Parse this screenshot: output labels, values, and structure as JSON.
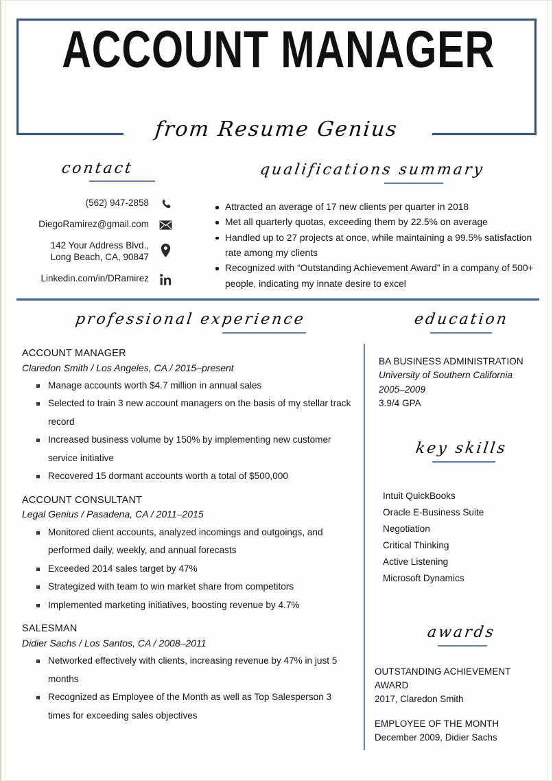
{
  "header": {
    "title": "ACCOUNT MANAGER",
    "subtitle": "from Resume Genius",
    "border_color": "#3d5574",
    "accent_color": "#4a6c96"
  },
  "sections": {
    "contact_heading": "contact",
    "qualifications_heading": "qualifications summary",
    "experience_heading": "professional experience",
    "education_heading": "education",
    "skills_heading": "key skills",
    "awards_heading": "awards"
  },
  "contact": {
    "items": [
      {
        "icon": "phone-icon",
        "lines": [
          "(562) 947-2858"
        ]
      },
      {
        "icon": "envelope-icon",
        "lines": [
          "DiegoRamirez@gmail.com"
        ]
      },
      {
        "icon": "location-pin-icon",
        "lines": [
          "142 Your Address Blvd.,",
          "Long Beach, CA, 90847"
        ]
      },
      {
        "icon": "linkedin-icon",
        "lines": [
          "Linkedin.com/in/DRamirez"
        ]
      }
    ],
    "phone": "(562) 947-2858",
    "email": "DiegoRamirez@gmail.com",
    "address_line1": "142 Your Address Blvd.,",
    "address_line2": "Long Beach, CA, 90847",
    "linkedin": "Linkedin.com/in/DRamirez"
  },
  "qualifications": [
    "Attracted an average of 17 new clients per quarter in 2018",
    "Met all quarterly quotas, exceeding them by 22.5% on average",
    "Handled up to 27 projects at once, while maintaining a 99.5% satisfaction rate among my clients",
    "Recognized with “Outstanding Achievement Award” in a company of 500+ people, indicating my innate desire to excel"
  ],
  "experience": [
    {
      "title": "ACCOUNT MANAGER",
      "meta": "Claredon Smith / Los Angeles, CA / 2015–present",
      "bullets": [
        "Manage accounts worth $4.7 million in annual sales",
        "Selected to train 3 new account managers on the basis of my stellar track record",
        "Increased business volume by 150% by implementing new customer service initiative",
        "Recovered 15 dormant accounts worth a total of $500,000"
      ]
    },
    {
      "title": "ACCOUNT CONSULTANT",
      "meta": "Legal Genius / Pasadena, CA  / 2011–2015",
      "bullets": [
        "Monitored client accounts, analyzed incomings and outgoings, and performed daily, weekly, and annual forecasts",
        "Exceeded 2014 sales target by 47%",
        "Strategized with team to win market share from competitors",
        "Implemented marketing initiatives, boosting revenue by 4.7%"
      ]
    },
    {
      "title": "SALESMAN",
      "meta": "Didier Sachs / Los Santos, CA / 2008–2011",
      "bullets": [
        "Networked effectively with clients, increasing revenue by 47% in just 5 months",
        "Recognized as Employee of the Month as well as Top Salesperson 3 times for exceeding sales objectives"
      ]
    }
  ],
  "education": {
    "degree": "BA BUSINESS ADMINISTRATION",
    "school": "University of Southern California",
    "years": "2005–2009",
    "gpa": "3.9/4 GPA"
  },
  "skills": [
    "Intuit QuickBooks",
    "Oracle E-Business Suite",
    "Negotiation",
    "Critical Thinking",
    "Active Listening",
    "Microsoft Dynamics"
  ],
  "awards": [
    {
      "name": "OUTSTANDING ACHIEVEMENT AWARD",
      "detail": "2017, Claredon Smith"
    },
    {
      "name": "EMPLOYEE OF THE MONTH",
      "detail": "December 2009, Didier Sachs"
    }
  ]
}
